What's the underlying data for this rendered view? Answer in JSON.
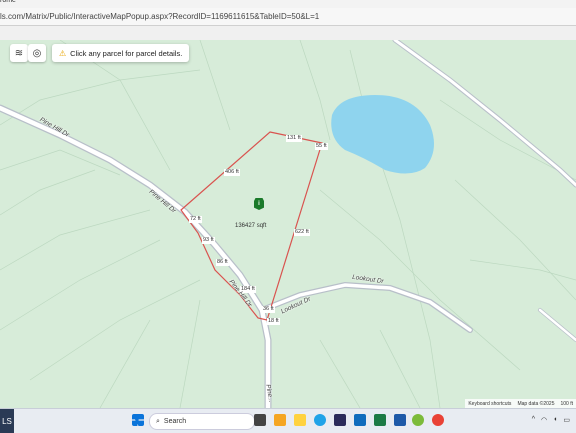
{
  "browser": {
    "title_fragment": "rome",
    "url": "ls.com/Matrix/Public/InteractiveMapPopup.aspx?RecordID=1169611615&TableID=50&L=1"
  },
  "map": {
    "notice": "Click any parcel for parcel details.",
    "area_label": "136427 sqft",
    "pin_label": "i",
    "measurements": [
      "131 ft",
      "55 ft",
      "406 ft",
      "72 ft",
      "622 ft",
      "93 ft",
      "86 ft",
      "184 ft",
      "36 ft",
      "18 ft"
    ],
    "roads": [
      "Pine Hill Dr",
      "Pine Hill Dr",
      "Pine Hill Dr",
      "Lookout Dr",
      "Lookout Dr",
      "Pine..."
    ],
    "attribution": {
      "shortcuts": "Keyboard shortcuts",
      "data": "Map data ©2025",
      "scale": "100 ft"
    },
    "colors": {
      "land": "#d7ecd9",
      "water": "#8fd4ee",
      "road": "#b8bfc9",
      "boundary": "#d9534f"
    }
  },
  "taskbar": {
    "left_label": "LS",
    "search_placeholder": "Search",
    "icons": [
      "start-icon",
      "search-icon",
      "task-view-icon",
      "widgets-icon",
      "file-explorer-icon",
      "edge-icon",
      "store-icon",
      "outlook-icon",
      "excel-icon",
      "app-icon",
      "chrome-icon"
    ]
  }
}
